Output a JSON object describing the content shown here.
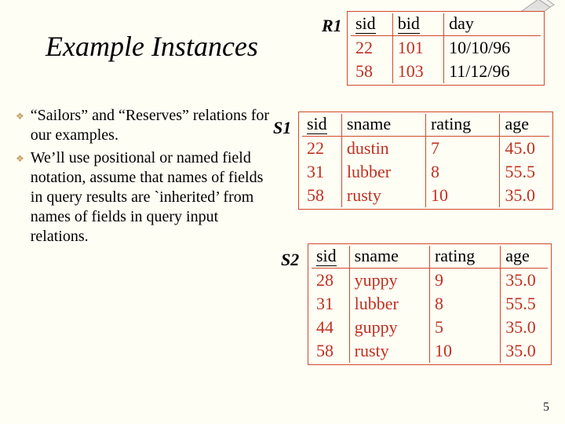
{
  "title": "Example Instances",
  "bullets": [
    "“Sailors” and “Reserves” relations for our examples.",
    "We’ll use positional or named field notation, assume that names of fields in query results are `inherited’ from names of fields in query input relations."
  ],
  "labels": {
    "r1": "R1",
    "s1": "S1",
    "s2": "S2"
  },
  "r1": {
    "headers": [
      "sid",
      "bid",
      "day"
    ],
    "underline": [
      true,
      true,
      false
    ],
    "rows": [
      [
        "22",
        "101",
        "10/10/96"
      ],
      [
        "58",
        "103",
        "11/12/96"
      ]
    ]
  },
  "s1": {
    "headers": [
      "sid",
      "sname",
      "rating",
      "age"
    ],
    "underline": [
      true,
      false,
      false,
      false
    ],
    "rows": [
      [
        "22",
        "dustin",
        "7",
        "45.0"
      ],
      [
        "31",
        "lubber",
        "8",
        "55.5"
      ],
      [
        "58",
        "rusty",
        "10",
        "35.0"
      ]
    ]
  },
  "s2": {
    "headers": [
      "sid",
      "sname",
      "rating",
      "age"
    ],
    "underline": [
      true,
      false,
      false,
      false
    ],
    "rows": [
      [
        "28",
        "yuppy",
        "9",
        "35.0"
      ],
      [
        "31",
        "lubber",
        "8",
        "55.5"
      ],
      [
        "44",
        "guppy",
        "5",
        "35.0"
      ],
      [
        "58",
        "rusty",
        "10",
        "35.0"
      ]
    ]
  },
  "page_number": "5"
}
